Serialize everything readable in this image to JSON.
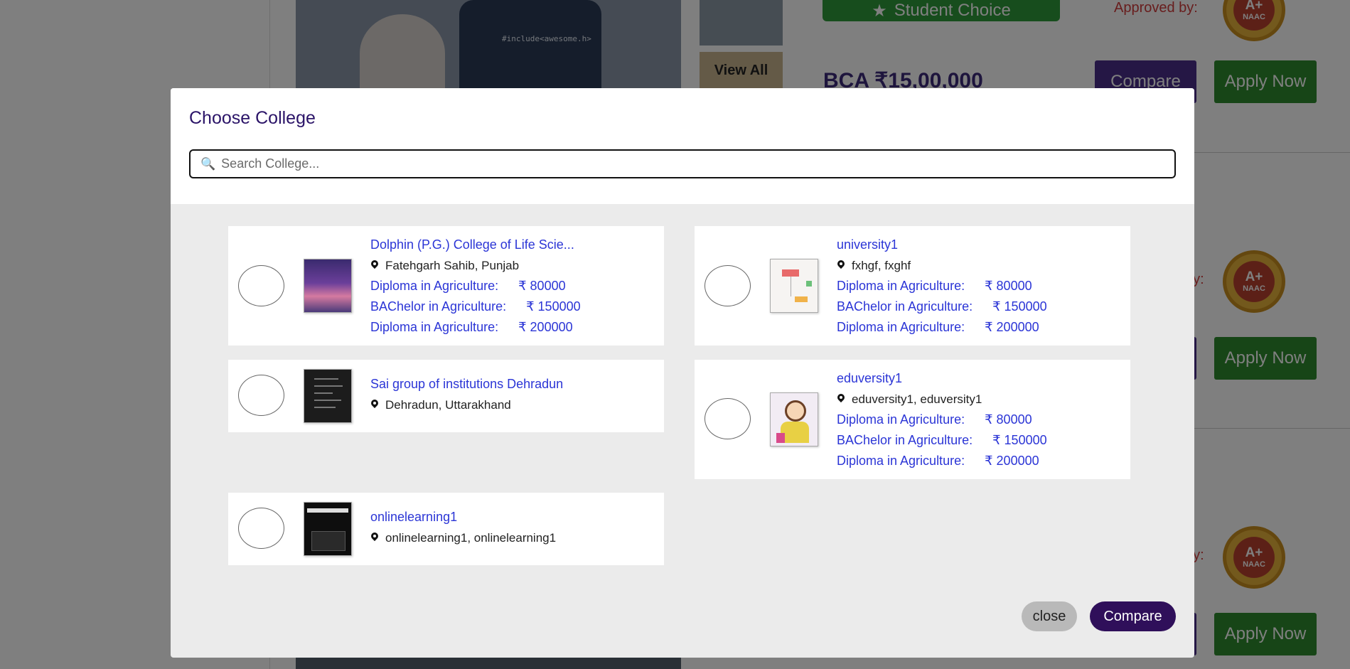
{
  "background": {
    "hero_shirt_text": "#include<awesome.h>",
    "view_all_label": "View All",
    "student_choice_label": "Student Choice",
    "approved_label": "Approved by:",
    "approved_label_short": "by:",
    "price_label": "BCA ₹15,00,000",
    "compare_label": "Compare",
    "apply_label": "Apply Now",
    "naac_grade": "A+",
    "naac_label": "NAAC"
  },
  "modal": {
    "title": "Choose College",
    "search_placeholder": "Search College...",
    "close_label": "close",
    "compare_label": "Compare"
  },
  "colleges": [
    {
      "name": "Dolphin (P.G.) College of Life Scie...",
      "location": "Fatehgarh Sahib, Punjab",
      "courses": [
        {
          "name": "Diploma in Agriculture:",
          "fee": "₹ 80000"
        },
        {
          "name": "BAChelor in Agriculture:",
          "fee": "₹ 150000"
        },
        {
          "name": "Diploma in Agriculture:",
          "fee": "₹ 200000"
        }
      ]
    },
    {
      "name": "university1",
      "location": "fxhgf, fxghf",
      "courses": [
        {
          "name": "Diploma in Agriculture:",
          "fee": "₹ 80000"
        },
        {
          "name": "BAChelor in Agriculture:",
          "fee": "₹ 150000"
        },
        {
          "name": "Diploma in Agriculture:",
          "fee": "₹ 200000"
        }
      ]
    },
    {
      "name": "Sai group of institutions Dehradun",
      "location": "Dehradun, Uttarakhand",
      "courses": []
    },
    {
      "name": "eduversity1",
      "location": "eduversity1, eduversity1",
      "courses": [
        {
          "name": "Diploma in Agriculture:",
          "fee": "₹ 80000"
        },
        {
          "name": "BAChelor in Agriculture:",
          "fee": "₹ 150000"
        },
        {
          "name": "Diploma in Agriculture:",
          "fee": "₹ 200000"
        }
      ]
    },
    {
      "name": "onlinelearning1",
      "location": "onlinelearning1, onlinelearning1",
      "courses": []
    }
  ],
  "colors": {
    "accent": "#2f0f5a",
    "link": "#2b35d6",
    "title": "#2b1468"
  }
}
